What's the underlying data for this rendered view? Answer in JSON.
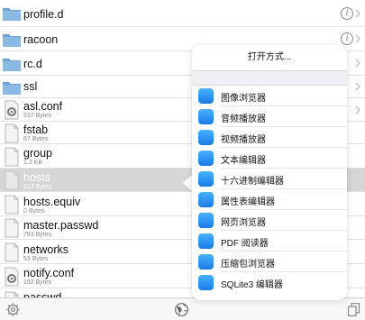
{
  "files": [
    {
      "name": "profile.d",
      "kind": "folder",
      "size": "",
      "info": "i"
    },
    {
      "name": "racoon",
      "kind": "folder",
      "size": "",
      "info": "i"
    },
    {
      "name": "rc.d",
      "kind": "folder",
      "size": "",
      "info": ""
    },
    {
      "name": "ssl",
      "kind": "folder",
      "size": "",
      "info": ""
    },
    {
      "name": "asl.conf",
      "kind": "config",
      "size": "537 Bytes",
      "info": ""
    },
    {
      "name": "fstab",
      "kind": "doc",
      "size": "67 Bytes",
      "info": ""
    },
    {
      "name": "group",
      "kind": "doc",
      "size": "1.2 KB",
      "info": ""
    },
    {
      "name": "hosts",
      "kind": "doc",
      "size": "213 Bytes",
      "info": ""
    },
    {
      "name": "hosts.equiv",
      "kind": "doc",
      "size": "0 Bytes",
      "info": ""
    },
    {
      "name": "master.passwd",
      "kind": "doc",
      "size": "783 Bytes",
      "info": ""
    },
    {
      "name": "networks",
      "kind": "doc",
      "size": "53 Bytes",
      "info": ""
    },
    {
      "name": "notify.conf",
      "kind": "config",
      "size": "192 Bytes",
      "info": ""
    },
    {
      "name": "passwd",
      "kind": "doc",
      "size": "",
      "info": ""
    }
  ],
  "popover": {
    "title": "打开方式...",
    "items": [
      "图像浏览器",
      "音频播放器",
      "视频播放器",
      "文本编辑器",
      "十六进制编辑器",
      "属性表编辑器",
      "网页浏览器",
      "PDF 阅读器",
      "压缩包浏览器",
      "SQLite3 编辑器"
    ]
  },
  "toolbar": {
    "left_icon": "gear-icon",
    "center_icon": "globe-icon",
    "right_icon": "copy-icon"
  },
  "colors": {
    "folder": "#6fa3d8",
    "selected_row": "#d6d6d6",
    "app_icon": "#2b8ff0"
  }
}
